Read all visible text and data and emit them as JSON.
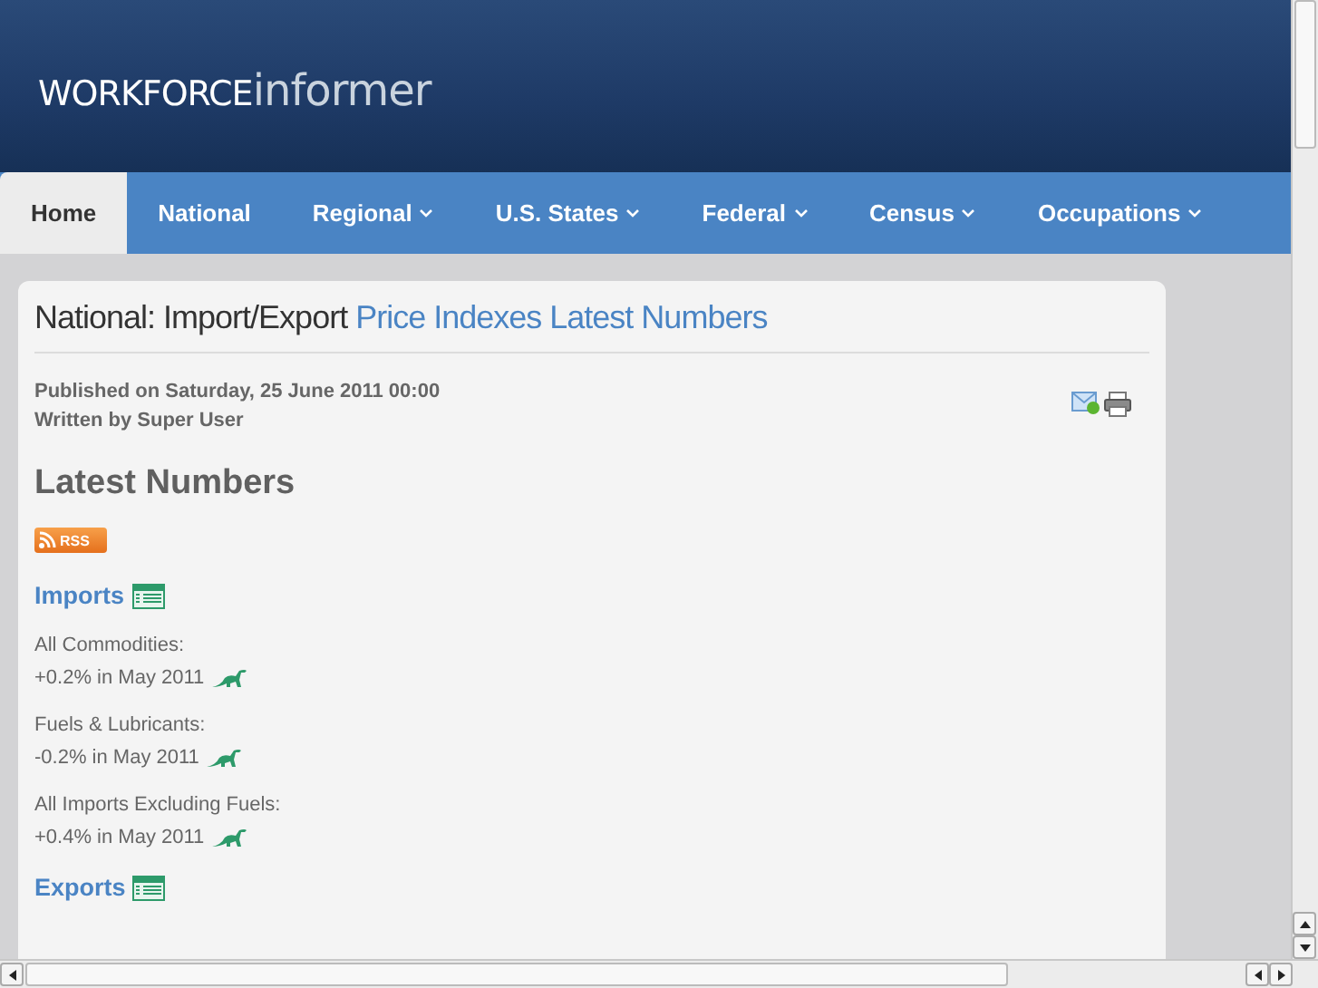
{
  "logo": {
    "part_1": "WORKFORCE",
    "part_2": "informer"
  },
  "nav": [
    {
      "label": "Home",
      "selected": true,
      "dropdown": false
    },
    {
      "label": "National",
      "selected": false,
      "dropdown": false
    },
    {
      "label": "Regional",
      "selected": false,
      "dropdown": true
    },
    {
      "label": "U.S. States",
      "selected": false,
      "dropdown": true
    },
    {
      "label": "Federal",
      "selected": false,
      "dropdown": true
    },
    {
      "label": "Census",
      "selected": false,
      "dropdown": true
    },
    {
      "label": "Occupations",
      "selected": false,
      "dropdown": true
    }
  ],
  "article": {
    "title": "National: Import/Export",
    "title_link": "Price Indexes Latest Numbers",
    "published": "Published on Saturday, 25 June 2011 00:00",
    "author": "Written by Super User",
    "heading": "Latest Numbers",
    "rss": "RSS",
    "sections": [
      {
        "title": "Imports",
        "items": [
          {
            "label": "All Commodities:",
            "value": "+0.2% in May 2011"
          },
          {
            "label": "Fuels & Lubricants:",
            "value": "-0.2% in May 2011"
          },
          {
            "label": "All Imports Excluding Fuels:",
            "value": "+0.4% in May 2011"
          }
        ]
      },
      {
        "title": "Exports"
      }
    ]
  }
}
